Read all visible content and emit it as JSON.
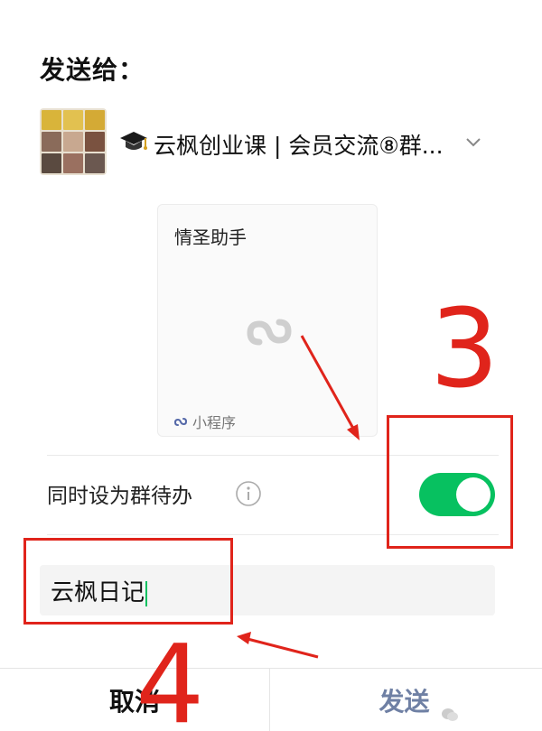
{
  "dialog": {
    "title": "发送给：",
    "recipient": {
      "group_name": "云枫创业课 | 会员交流⑧群...",
      "avatar_icon": "group-avatar",
      "prefix_icon": "graduation-cap-icon",
      "dropdown_icon": "chevron-down-icon"
    },
    "card": {
      "title": "情圣助手",
      "footer_label": "小程序",
      "center_icon": "link-icon"
    },
    "todo": {
      "label": "同时设为群待办",
      "toggle_on": true,
      "info_icon": "info-icon"
    },
    "message": {
      "value": "云枫日记"
    },
    "buttons": {
      "cancel_label": "取消",
      "send_label": "发送"
    }
  },
  "annotations": {
    "step_3": "3",
    "step_4": "4",
    "color": "#e0241b"
  },
  "colors": {
    "toggle": "#07c160",
    "send": "#576b95"
  }
}
